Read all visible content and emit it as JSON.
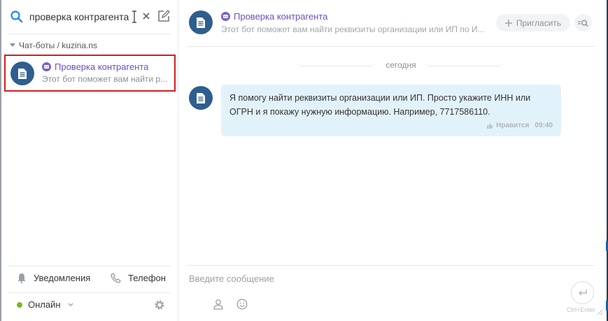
{
  "search": {
    "value": "проверка контрагента"
  },
  "sidebar": {
    "group_label": "Чат-боты / kuzina.ns",
    "chat": {
      "title": "Проверка контрагента",
      "preview": "Этот бот поможет вам найти р..."
    },
    "footer": {
      "notifications_label": "Уведомления",
      "phone_label": "Телефон",
      "status_label": "Онлайн"
    }
  },
  "header": {
    "title": "Проверка контрагента",
    "subtitle": "Этот бот поможет вам найти реквизиты организации или ИП по И...",
    "invite_label": "Пригласить"
  },
  "conversation": {
    "date_separator": "сегодня",
    "message": {
      "text": "Я помогу найти реквизиты организации или ИП. Просто укажите ИНН или ОГРН и я покажу нужную информацию. Например, 7717586110.",
      "like_label": "Нравится",
      "time": "09:40"
    }
  },
  "composer": {
    "placeholder": "Введите сообщение",
    "send_hint": "Ctrl+Enter"
  },
  "colors": {
    "accent_purple": "#6a4fc9",
    "avatar_blue": "#2f5e8e",
    "bubble_bg": "#e2f2fb",
    "highlight_red": "#d11f1f",
    "online_green": "#7cb727"
  },
  "icons": [
    "search-icon",
    "clear-icon",
    "compose-icon",
    "bot-icon",
    "document-icon",
    "bell-icon",
    "phone-icon",
    "gear-icon",
    "plus-icon",
    "find-in-chat-icon",
    "like-icon",
    "person-icon",
    "smile-icon",
    "send-icon"
  ]
}
